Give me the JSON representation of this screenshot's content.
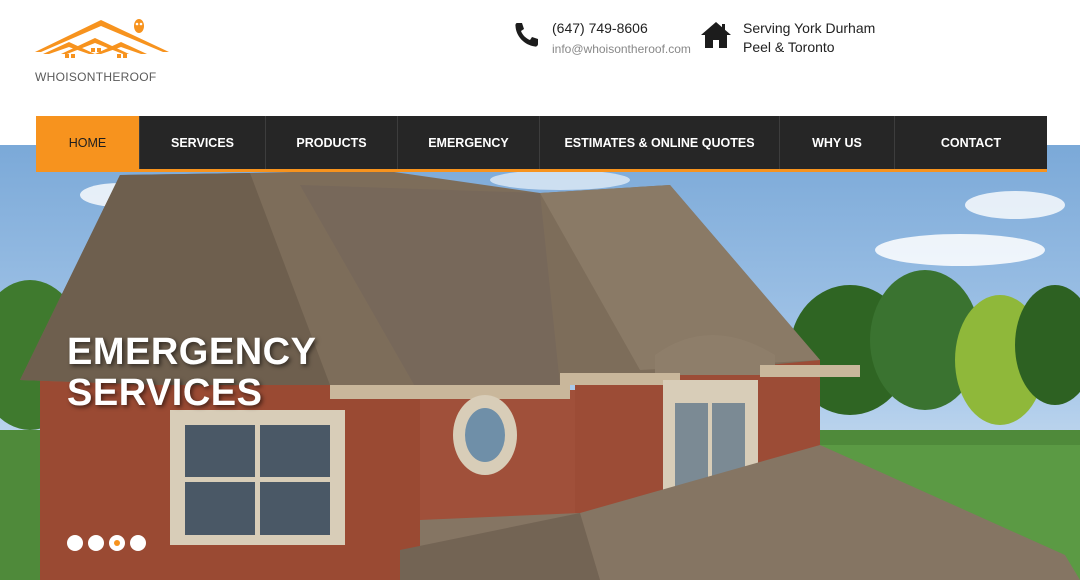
{
  "brand": {
    "name": "WHOISONTHEROOF",
    "accent": "#f7931e"
  },
  "contact": {
    "phone": "(647) 749-8606",
    "email": "info@whoisontheroof.com",
    "phone_icon": "phone-icon"
  },
  "location": {
    "line1": "Serving York Durham",
    "line2": "Peel & Toronto",
    "icon": "home-icon"
  },
  "nav": {
    "items": [
      {
        "label": "HOME",
        "active": true
      },
      {
        "label": "SERVICES"
      },
      {
        "label": "PRODUCTS"
      },
      {
        "label": "EMERGENCY"
      },
      {
        "label": "ESTIMATES & ONLINE QUOTES"
      },
      {
        "label": "WHY US"
      },
      {
        "label": "CONTACT"
      }
    ]
  },
  "hero": {
    "title_line1": "EMERGENCY",
    "title_line2": "SERVICES",
    "slides": 4,
    "active_slide": 3
  }
}
